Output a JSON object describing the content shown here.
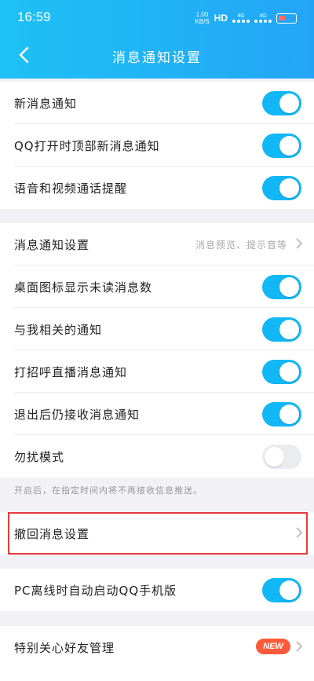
{
  "status_bar": {
    "time": "16:59",
    "net_speed_value": "1.00",
    "net_speed_unit": "KB/S",
    "hd_label": "HD",
    "network_1": "4G",
    "network_2": "4G"
  },
  "nav": {
    "back_icon": "chevron-left-icon",
    "title": "消息通知设置"
  },
  "section1": {
    "items": [
      {
        "label": "新消息通知",
        "toggle": "on"
      },
      {
        "label": "QQ打开时顶部新消息通知",
        "toggle": "on"
      },
      {
        "label": "语音和视频通话提醒",
        "toggle": "on"
      }
    ]
  },
  "section2": {
    "items": [
      {
        "label": "消息通知设置",
        "value": "消息预览、提示音等"
      },
      {
        "label": "桌面图标显示未读消息数",
        "toggle": "on"
      },
      {
        "label": "与我相关的通知",
        "toggle": "on"
      },
      {
        "label": "打招呼直播消息通知",
        "toggle": "on"
      },
      {
        "label": "退出后仍接收消息通知",
        "toggle": "on"
      },
      {
        "label": "勿扰模式",
        "toggle": "off"
      }
    ],
    "hint": "开启后，在指定时间内将不再接收信息推送。"
  },
  "section3": {
    "items": [
      {
        "label": "撤回消息设置"
      }
    ]
  },
  "section4": {
    "items": [
      {
        "label": "PC离线时自动启动QQ手机版",
        "toggle": "on"
      }
    ]
  },
  "section5": {
    "items": [
      {
        "label": "特别关心好友管理",
        "badge": "NEW"
      }
    ]
  },
  "colors": {
    "accent": "#12b7f5",
    "header_start": "#1ec1f5",
    "header_end": "#23a5f6",
    "highlight": "#e53c3c",
    "badge": "#fd5b3b"
  }
}
